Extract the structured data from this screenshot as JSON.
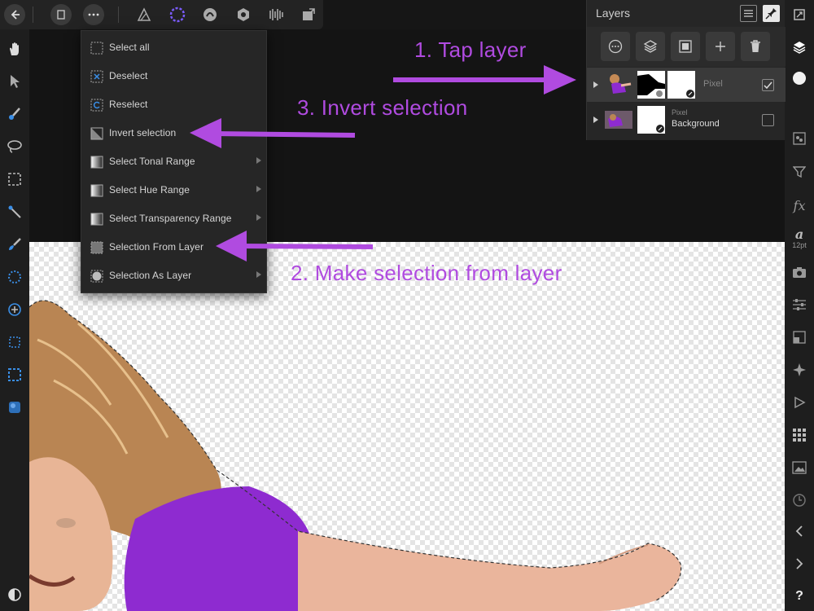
{
  "menu": {
    "items": [
      {
        "label": "Select all",
        "icon": "select-all-icon",
        "submenu": false
      },
      {
        "label": "Deselect",
        "icon": "deselect-icon",
        "submenu": false
      },
      {
        "label": "Reselect",
        "icon": "reselect-icon",
        "submenu": false
      },
      {
        "label": "Invert selection",
        "icon": "invert-selection-icon",
        "submenu": false
      },
      {
        "label": "Select Tonal Range",
        "icon": "tonal-range-icon",
        "submenu": true
      },
      {
        "label": "Select Hue Range",
        "icon": "hue-range-icon",
        "submenu": true
      },
      {
        "label": "Select Transparency Range",
        "icon": "transparency-range-icon",
        "submenu": true
      },
      {
        "label": "Selection From Layer",
        "icon": "selection-from-layer-icon",
        "submenu": false
      },
      {
        "label": "Selection As Layer",
        "icon": "selection-as-layer-icon",
        "submenu": true
      }
    ]
  },
  "layers": {
    "title": "Layers",
    "rows": [
      {
        "type": "Pixel",
        "name": "",
        "checked": true
      },
      {
        "type": "Pixel",
        "name": "Background",
        "checked": false
      }
    ]
  },
  "right_bar": {
    "text_size": "12pt"
  },
  "annotations": {
    "step1": "1. Tap layer",
    "step2": "2. Make selection from layer",
    "step3": "3. Invert selection"
  },
  "colors": {
    "annotation": "#b04be0",
    "shirt": "#8e2bd0",
    "accent": "#3a8ee6"
  }
}
